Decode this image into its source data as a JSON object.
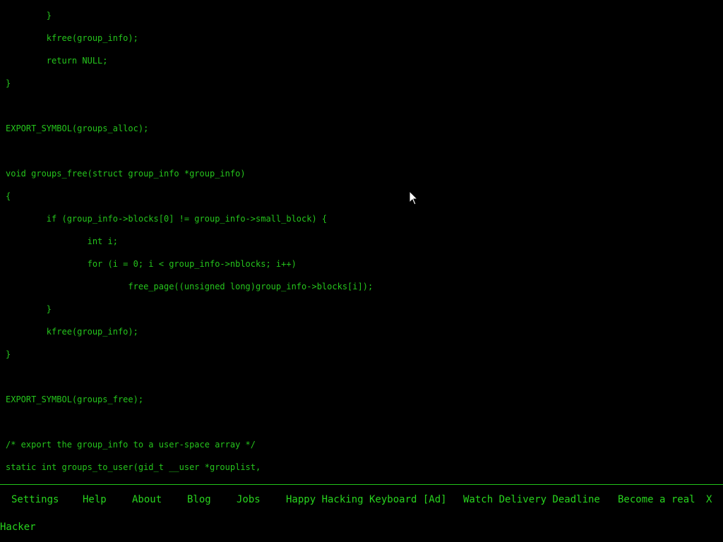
{
  "editor": {
    "lines": [
      "\t}",
      "\tkfree(group_info);",
      "\treturn NULL;",
      "}",
      "",
      "EXPORT_SYMBOL(groups_alloc);",
      "",
      "void groups_free(struct group_info *group_info)",
      "{",
      "\tif (group_info->blocks[0] != group_info->small_block) {",
      "\t\tint i;",
      "\t\tfor (i = 0; i < group_info->nblocks; i++)",
      "\t\t\tfree_page((unsigned long)group_info->blocks[i]);",
      "\t}",
      "\tkfree(group_info);",
      "}",
      "",
      "EXPORT_SYMBOL(groups_free);",
      "",
      "/* export the group_info to a user-space array */",
      "static int groups_to_user(gid_t __user *grouplist,"
    ]
  },
  "footer": {
    "settings": "Settings",
    "help": "Help",
    "about": "About",
    "blog": "Blog",
    "jobs": "Jobs",
    "ad_link": "Happy Hacking Keyboard [Ad]",
    "watch_link": "Watch Delivery Deadline",
    "become_line1": "Become a real",
    "become_line2": "Hacker",
    "close": "X"
  },
  "colors": {
    "code_text": "#25c41c",
    "footer_text": "#28d41e",
    "background": "#000000"
  },
  "icons": {
    "cursor": "mouse-pointer-icon"
  }
}
